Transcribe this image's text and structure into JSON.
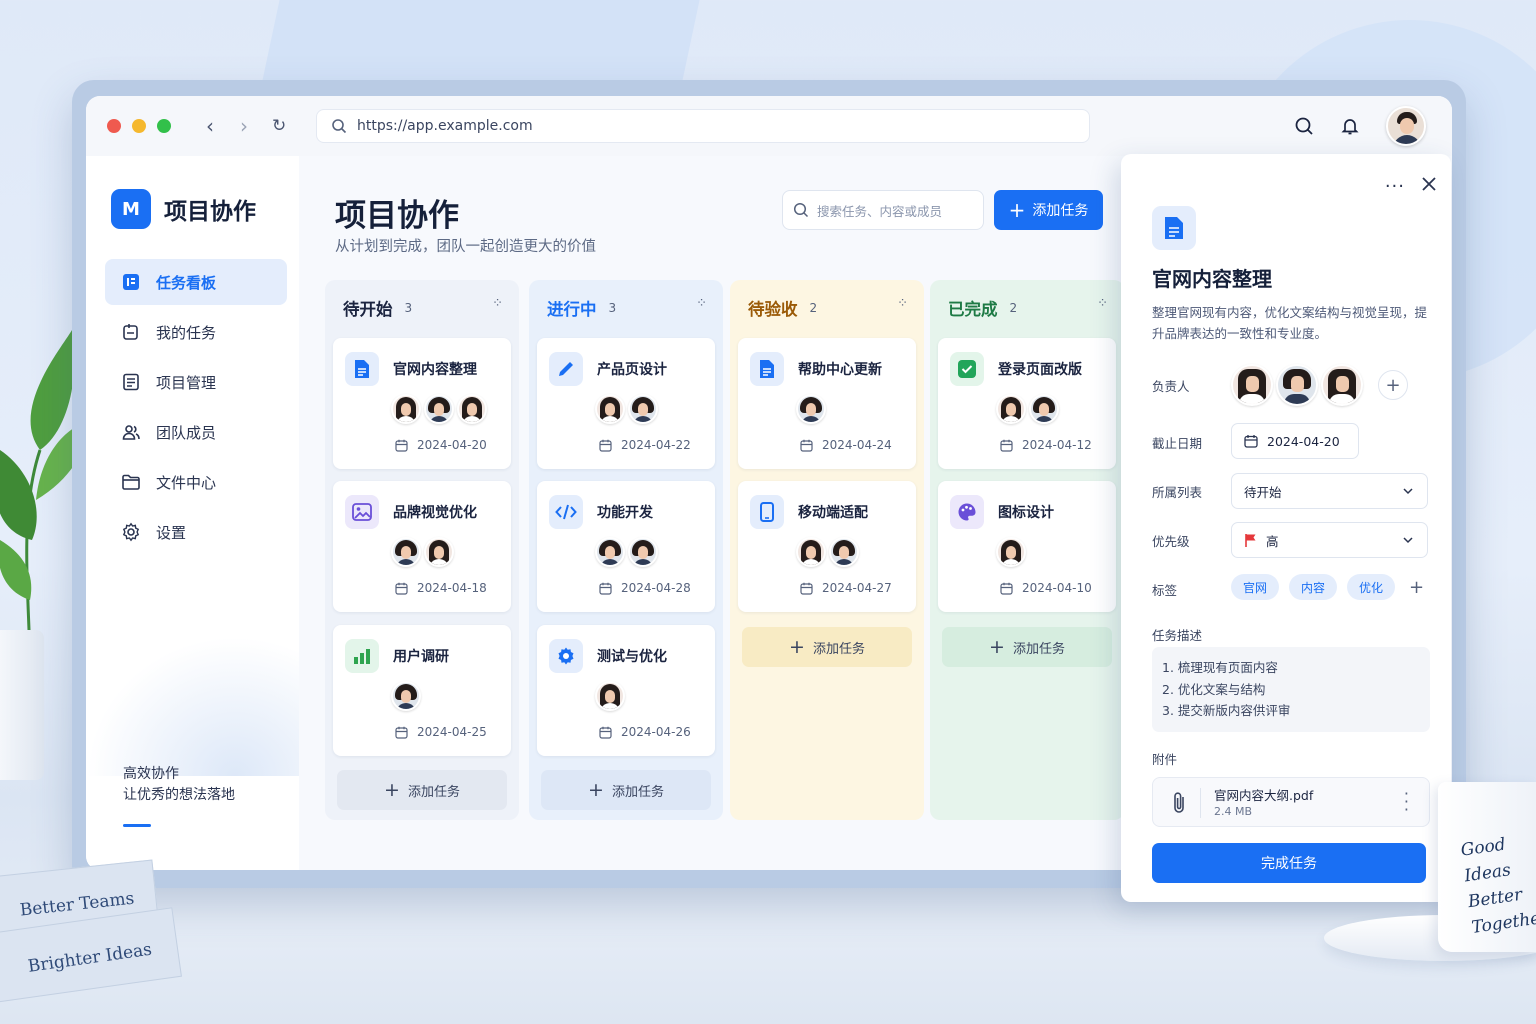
{
  "browser": {
    "url": "https://app.example.com"
  },
  "sidebar": {
    "app_name": "项目协作",
    "logo_letter": "M",
    "items": [
      {
        "label": "任务看板",
        "icon": "board-icon",
        "active": true
      },
      {
        "label": "我的任务",
        "icon": "my-task-icon",
        "active": false
      },
      {
        "label": "项目管理",
        "icon": "project-icon",
        "active": false
      },
      {
        "label": "团队成员",
        "icon": "team-icon",
        "active": false
      },
      {
        "label": "文件中心",
        "icon": "folder-icon",
        "active": false
      },
      {
        "label": "设置",
        "icon": "gear-icon",
        "active": false
      }
    ],
    "footer_line1": "高效协作",
    "footer_line2": "让优秀的想法落地"
  },
  "main": {
    "title": "项目协作",
    "subtitle": "从计划到完成，团队一起创造更大的价值",
    "search_placeholder": "搜索任务、内容或成员",
    "add_button": "添加任务",
    "add_column_label": "添加任务",
    "columns": [
      {
        "name": "待开始",
        "count": "3",
        "color": "#1b2440",
        "cards": [
          {
            "title": "官网内容整理",
            "icon": "document-icon",
            "assignees": [
              "f",
              "m",
              "f"
            ],
            "date": "2024-04-20"
          },
          {
            "title": "品牌视觉优化",
            "icon": "image-icon",
            "assignees": [
              "m",
              "f"
            ],
            "date": "2024-04-18"
          },
          {
            "title": "用户调研",
            "icon": "bar-chart-icon",
            "assignees": [
              "m"
            ],
            "date": "2024-04-25"
          }
        ]
      },
      {
        "name": "进行中",
        "count": "3",
        "color": "#1a6ff3",
        "cards": [
          {
            "title": "产品页设计",
            "icon": "pencil-icon",
            "assignees": [
              "f",
              "m"
            ],
            "date": "2024-04-22"
          },
          {
            "title": "功能开发",
            "icon": "code-icon",
            "assignees": [
              "m",
              "m"
            ],
            "date": "2024-04-28"
          },
          {
            "title": "测试与优化",
            "icon": "gear-icon",
            "assignees": [
              "f"
            ],
            "date": "2024-04-26"
          }
        ]
      },
      {
        "name": "待验收",
        "count": "2",
        "color": "#9a5a07",
        "cards": [
          {
            "title": "帮助中心更新",
            "icon": "document-icon",
            "assignees": [
              "m"
            ],
            "date": "2024-04-24"
          },
          {
            "title": "移动端适配",
            "icon": "mobile-icon",
            "assignees": [
              "f",
              "m"
            ],
            "date": "2024-04-27"
          }
        ]
      },
      {
        "name": "已完成",
        "count": "2",
        "color": "#1e7a45",
        "cards": [
          {
            "title": "登录页面改版",
            "icon": "check-icon",
            "assignees": [
              "f",
              "m"
            ],
            "date": "2024-04-12"
          },
          {
            "title": "图标设计",
            "icon": "palette-icon",
            "assignees": [
              "f"
            ],
            "date": "2024-04-10"
          }
        ]
      }
    ]
  },
  "detail": {
    "title": "官网内容整理",
    "description": "整理官网现有内容，优化文案结构与视觉呈现，提升品牌表达的一致性和专业度。",
    "labels": {
      "assignee": "负责人",
      "due": "截止日期",
      "list": "所属列表",
      "priority": "优先级",
      "tags": "标签",
      "task_desc": "任务描述",
      "attachments": "附件"
    },
    "due_date": "2024-04-20",
    "list_value": "待开始",
    "priority_value": "高",
    "tags": [
      "官网",
      "内容",
      "优化"
    ],
    "steps": [
      "1. 梳理现有页面内容",
      "2. 优化文案与结构",
      "3. 提交新版内容供评审"
    ],
    "attachment_name": "官网内容大纲.pdf",
    "attachment_size": "2.4 MB",
    "complete_button": "完成任务"
  },
  "decor": {
    "book_top": "Better Teams",
    "book_bottom": "Brighter Ideas",
    "mug_lines": [
      "Good",
      "Ideas",
      "Better",
      "Together"
    ]
  },
  "colors": {
    "accent": "#1a6ff3",
    "col_todo_bg": "#eef2f9",
    "col_doing_bg": "#e8f0fb",
    "col_review_bg": "#fdf6e2",
    "col_done_bg": "#e6f4ec"
  }
}
